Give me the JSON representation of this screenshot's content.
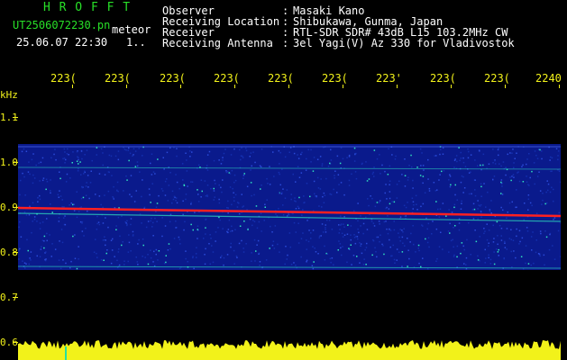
{
  "header": {
    "app_title": "H R O F F T",
    "file_name": "UT2506072230.pn",
    "mode": "meteor",
    "date_time": "25.06.07 22:30",
    "page_marker": "1..",
    "fields": [
      {
        "label": "Observer",
        "value": "Masaki Kano"
      },
      {
        "label": "Receiving Location",
        "value": "Shibukawa, Gunma, Japan"
      },
      {
        "label": "Receiver",
        "value": "RTL-SDR SDR# 43dB L15 103.2MHz CW"
      },
      {
        "label": "Receiving Antenna",
        "value": "3el Yagi(V) Az 330 for Vladivostok"
      }
    ],
    "colon": ":"
  },
  "time_axis": {
    "ticks": [
      "223(",
      "223(",
      "223(",
      "223(",
      "223(",
      "223(",
      "223'",
      "223(",
      "223(",
      "2240"
    ]
  },
  "freq_axis": {
    "unit": "kHz",
    "ticks": [
      "1.1",
      "1.0",
      "0.9",
      "0.8",
      "0.7",
      "0.6"
    ]
  },
  "colors": {
    "header_green": "#28e028",
    "axis_yellow": "#f2f21a",
    "waterfall_bg": "#0a1a8c",
    "signal_red": "#ff2020",
    "noise_cyan": "#30e0c0"
  }
}
